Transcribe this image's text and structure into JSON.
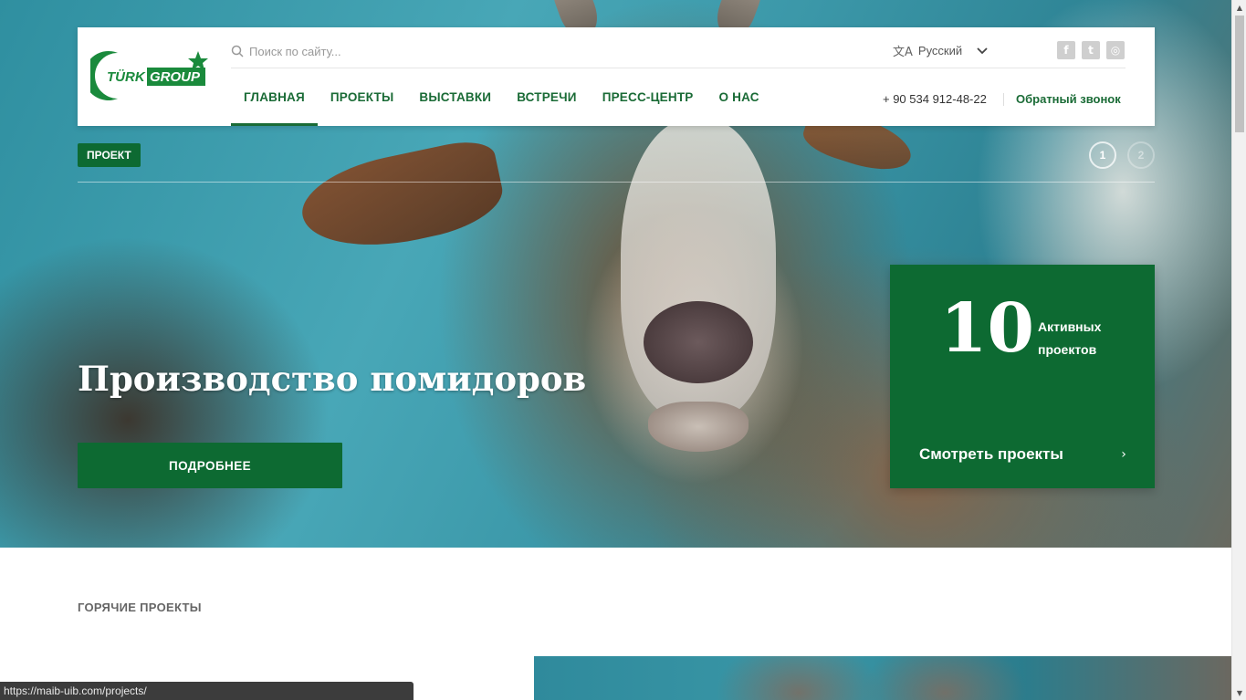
{
  "header": {
    "logo": {
      "text_left": "TÜRK",
      "text_right": "GROUP"
    },
    "search": {
      "placeholder": "Поиск по сайту..."
    },
    "language": {
      "label": "Русский"
    },
    "social": [
      "facebook-icon",
      "twitter-icon",
      "instagram-icon"
    ],
    "nav": [
      {
        "label": "ГЛАВНАЯ",
        "active": true
      },
      {
        "label": "ПРОЕКТЫ",
        "active": false
      },
      {
        "label": "ВЫСТАВКИ",
        "active": false
      },
      {
        "label": "ВСТРЕЧИ",
        "active": false
      },
      {
        "label": "ПРЕСС-ЦЕНТР",
        "active": false
      },
      {
        "label": "О НАС",
        "active": false
      }
    ],
    "phone": "+ 90 534 912-48-22",
    "callback": "Обратный звонок"
  },
  "hero": {
    "tag": "ПРОЕКТ",
    "title": "Производство помидоров",
    "button": "ПОДРОБНЕЕ",
    "pager": [
      {
        "label": "1",
        "active": true
      },
      {
        "label": "2",
        "active": false
      }
    ]
  },
  "stats": {
    "number": "10",
    "label": "Активных проектов",
    "link": "Смотреть проекты"
  },
  "section": {
    "title": "ГОРЯЧИЕ ПРОЕКТЫ"
  },
  "status_bar": {
    "url": "https://maib-uib.com/projects/"
  },
  "colors": {
    "brand_green": "#0d6a32",
    "nav_green": "#1a6b36"
  }
}
